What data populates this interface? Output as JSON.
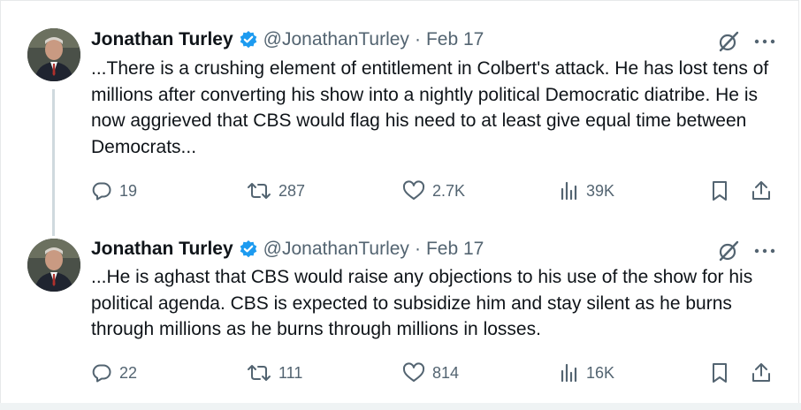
{
  "tweets": [
    {
      "author_name": "Jonathan Turley",
      "handle": "@JonathanTurley",
      "separator": "·",
      "date": "Feb 17",
      "text": "...There is a crushing element of entitlement in Colbert's attack. He has lost tens of millions after converting his show into a nightly political Democratic diatribe. He is now aggrieved that CBS would flag his need to at least give equal time between Democrats...",
      "replies": "19",
      "reposts": "287",
      "likes": "2.7K",
      "views": "39K"
    },
    {
      "author_name": "Jonathan Turley",
      "handle": "@JonathanTurley",
      "separator": "·",
      "date": "Feb 17",
      "text": "...He is aghast that CBS would raise any objections to his use of the show for his political agenda. CBS is expected to subsidize him and stay silent as he burns through millions as he burns through millions in losses.",
      "replies": "22",
      "reposts": "111",
      "likes": "814",
      "views": "16K"
    }
  ],
  "icons": {
    "verified": "verified-badge-icon",
    "grok": "grok-icon",
    "more": "more-icon",
    "reply": "reply-icon",
    "repost": "repost-icon",
    "like": "like-icon",
    "views": "views-icon",
    "bookmark": "bookmark-icon",
    "share": "share-icon"
  },
  "colors": {
    "verified_blue": "#1d9bf0",
    "text_primary": "#0f1419",
    "text_secondary": "#536471",
    "thread_line": "#cfd9de"
  }
}
